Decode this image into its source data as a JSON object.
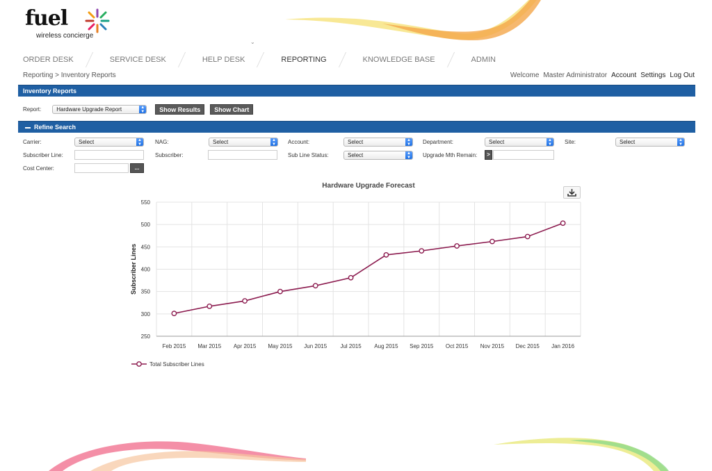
{
  "logo": {
    "word": "fuel",
    "sub": "wireless concierge"
  },
  "nav": [
    {
      "label": "ORDER DESK",
      "active": false
    },
    {
      "label": "SERVICE DESK",
      "active": false
    },
    {
      "label": "HELP DESK",
      "active": false
    },
    {
      "label": "REPORTING",
      "active": true
    },
    {
      "label": "KNOWLEDGE BASE",
      "active": false
    },
    {
      "label": "ADMIN",
      "active": false
    }
  ],
  "breadcrumb": "Reporting > Inventory Reports",
  "user": {
    "welcome": "Welcome",
    "name": "Master Administrator",
    "account": "Account",
    "settings": "Settings",
    "logout": "Log Out"
  },
  "section": {
    "title": "Inventory Reports",
    "refine": "Refine Search"
  },
  "report": {
    "label": "Report:",
    "selected": "Hardware Upgrade Report",
    "show_results": "Show Results",
    "show_chart": "Show Chart"
  },
  "filters": {
    "carrier": {
      "label": "Carrier:",
      "value": "Select"
    },
    "nag": {
      "label": "NAG:",
      "value": "Select"
    },
    "account": {
      "label": "Account:",
      "value": "Select"
    },
    "department": {
      "label": "Department:",
      "value": "Select"
    },
    "site": {
      "label": "Site:",
      "value": "Select"
    },
    "subscriber_line": {
      "label": "Subscriber Line:",
      "value": ""
    },
    "subscriber": {
      "label": "Subscriber:",
      "value": ""
    },
    "sub_line_status": {
      "label": "Sub Line Status:",
      "value": "Select"
    },
    "upgrade_mth": {
      "label": "Upgrade Mth Remain:",
      "operator": ">",
      "value": ""
    },
    "cost_center": {
      "label": "Cost Center:",
      "value": "",
      "browse": "..."
    }
  },
  "colors": {
    "accent": "#1f5fa3",
    "series": "#8b1a4e"
  },
  "chart_data": {
    "type": "line",
    "title": "Hardware Upgrade Forecast",
    "xlabel": "",
    "ylabel": "Subscriber Lines",
    "ylim": [
      250,
      550
    ],
    "yticks": [
      250,
      300,
      350,
      400,
      450,
      500,
      550
    ],
    "grid": true,
    "legend": "bottom-left",
    "categories": [
      "Feb 2015",
      "Mar 2015",
      "Apr 2015",
      "May 2015",
      "Jun 2015",
      "Jul 2015",
      "Aug 2015",
      "Sep 2015",
      "Oct 2015",
      "Nov 2015",
      "Dec 2015",
      "Jan 2016"
    ],
    "series": [
      {
        "name": "Total Subscriber Lines",
        "values": [
          301,
          317,
          329,
          350,
          363,
          381,
          432,
          441,
          452,
          462,
          473,
          503
        ]
      }
    ]
  }
}
